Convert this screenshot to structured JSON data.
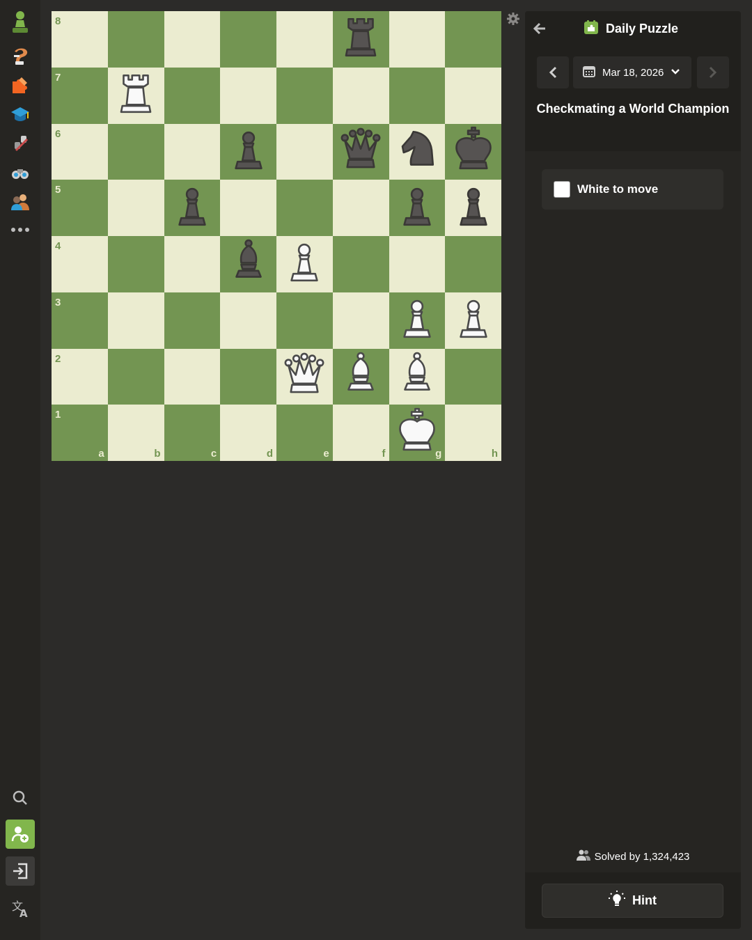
{
  "header": {
    "title": "Daily Puzzle",
    "date": "Mar 18, 2026",
    "puzzle_title": "Checkmating a World Champion"
  },
  "to_move": "White to move",
  "stats": {
    "solved_by": "Solved by 1,324,423"
  },
  "actions": {
    "hint_label": "Hint"
  },
  "board": {
    "files": [
      "a",
      "b",
      "c",
      "d",
      "e",
      "f",
      "g",
      "h"
    ],
    "ranks": [
      "8",
      "7",
      "6",
      "5",
      "4",
      "3",
      "2",
      "1"
    ],
    "light_color": "#ebecd0",
    "dark_color": "#739552",
    "pieces": [
      {
        "square": "f8",
        "type": "rook",
        "color": "black"
      },
      {
        "square": "b7",
        "type": "rook",
        "color": "white"
      },
      {
        "square": "d6",
        "type": "pawn",
        "color": "black"
      },
      {
        "square": "f6",
        "type": "queen",
        "color": "black"
      },
      {
        "square": "g6",
        "type": "knight",
        "color": "black"
      },
      {
        "square": "h6",
        "type": "king",
        "color": "black"
      },
      {
        "square": "c5",
        "type": "pawn",
        "color": "black"
      },
      {
        "square": "g5",
        "type": "pawn",
        "color": "black"
      },
      {
        "square": "h5",
        "type": "pawn",
        "color": "black"
      },
      {
        "square": "d4",
        "type": "bishop",
        "color": "black"
      },
      {
        "square": "e4",
        "type": "pawn",
        "color": "white"
      },
      {
        "square": "g3",
        "type": "pawn",
        "color": "white"
      },
      {
        "square": "h3",
        "type": "pawn",
        "color": "white"
      },
      {
        "square": "e2",
        "type": "queen",
        "color": "white"
      },
      {
        "square": "f2",
        "type": "bishop",
        "color": "white"
      },
      {
        "square": "g2",
        "type": "bishop",
        "color": "white"
      },
      {
        "square": "g1",
        "type": "king",
        "color": "white"
      }
    ]
  },
  "nav": {
    "items": [
      "pawn-logo-icon",
      "play-icon",
      "puzzles-icon",
      "learn-icon",
      "watch-icon",
      "news-icon",
      "social-icon",
      "more-icon"
    ],
    "bottom": [
      "search-icon",
      "sign-up-icon",
      "log-in-icon",
      "language-icon"
    ]
  },
  "colors": {
    "accent": "#81b64c",
    "panel_bg": "#262522",
    "page_bg": "#2c2b29"
  }
}
